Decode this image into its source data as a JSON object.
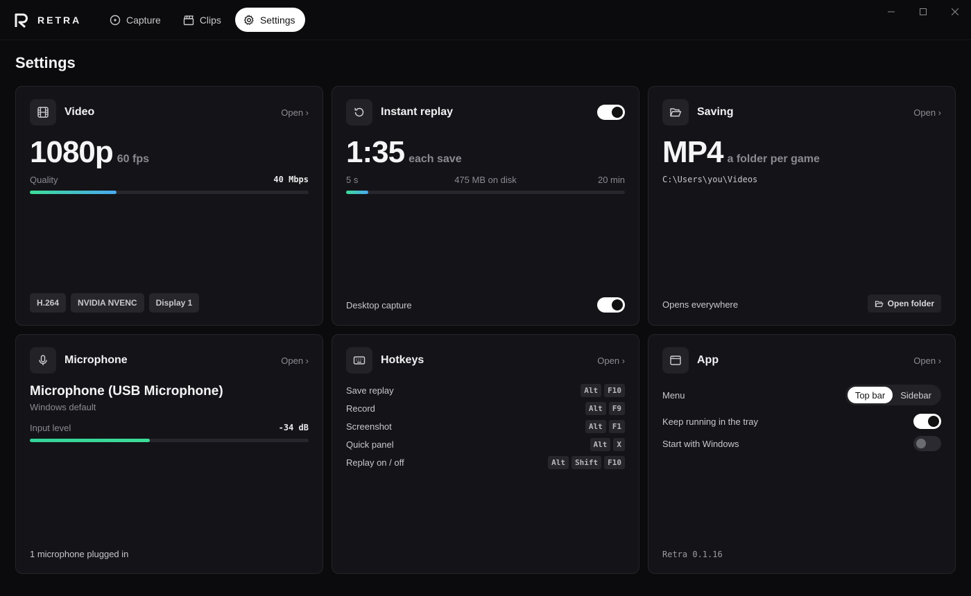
{
  "app": {
    "name": "RETRA"
  },
  "nav": {
    "tabs": [
      {
        "label": "Capture",
        "icon": "capture-icon"
      },
      {
        "label": "Clips",
        "icon": "clapperboard-icon"
      },
      {
        "label": "Settings",
        "icon": "gear-icon",
        "active": true
      }
    ]
  },
  "page": {
    "title": "Settings"
  },
  "video": {
    "title": "Video",
    "open": "Open ›",
    "resolution": "1080p",
    "fps": "60 fps",
    "quality_label": "Quality",
    "bitrate": "40 Mbps",
    "quality_level": 0.31,
    "chips": [
      "H.264",
      "NVIDIA NVENC",
      "Display 1"
    ]
  },
  "replay": {
    "title": "Instant replay",
    "enabled": true,
    "duration": "1:35",
    "duration_sub": "each save",
    "min": "5 s",
    "disk": "475 MB on disk",
    "max": "20 min",
    "level": 0.08,
    "desktop_label": "Desktop capture",
    "desktop_on": true
  },
  "saving": {
    "title": "Saving",
    "open": "Open ›",
    "format": "MP4",
    "format_sub": "a folder per game",
    "path": "C:\\Users\\you\\Videos",
    "opens_label": "Opens everywhere",
    "open_folder": "Open folder"
  },
  "microphone": {
    "title": "Microphone",
    "open": "Open ›",
    "device": "Microphone (USB Microphone)",
    "device_sub": "Windows default",
    "level_label": "Input level",
    "level_value": "-34 dB",
    "level": 0.43,
    "footer": "1 microphone plugged in"
  },
  "hotkeys": {
    "title": "Hotkeys",
    "open": "Open ›",
    "items": [
      {
        "label": "Save replay",
        "keys": [
          "Alt",
          "F10"
        ]
      },
      {
        "label": "Record",
        "keys": [
          "Alt",
          "F9"
        ]
      },
      {
        "label": "Screenshot",
        "keys": [
          "Alt",
          "F1"
        ]
      },
      {
        "label": "Quick panel",
        "keys": [
          "Alt",
          "X"
        ]
      },
      {
        "label": "Replay on / off",
        "keys": [
          "Alt",
          "Shift",
          "F10"
        ]
      }
    ]
  },
  "appcard": {
    "title": "App",
    "open": "Open ›",
    "menu_label": "Menu",
    "menu_options": [
      "Top bar",
      "Sidebar"
    ],
    "menu_selected": "Top bar",
    "tray_label": "Keep running in the tray",
    "tray_on": true,
    "startup_label": "Start with Windows",
    "startup_on": false,
    "version": "Retra 0.1.16"
  }
}
